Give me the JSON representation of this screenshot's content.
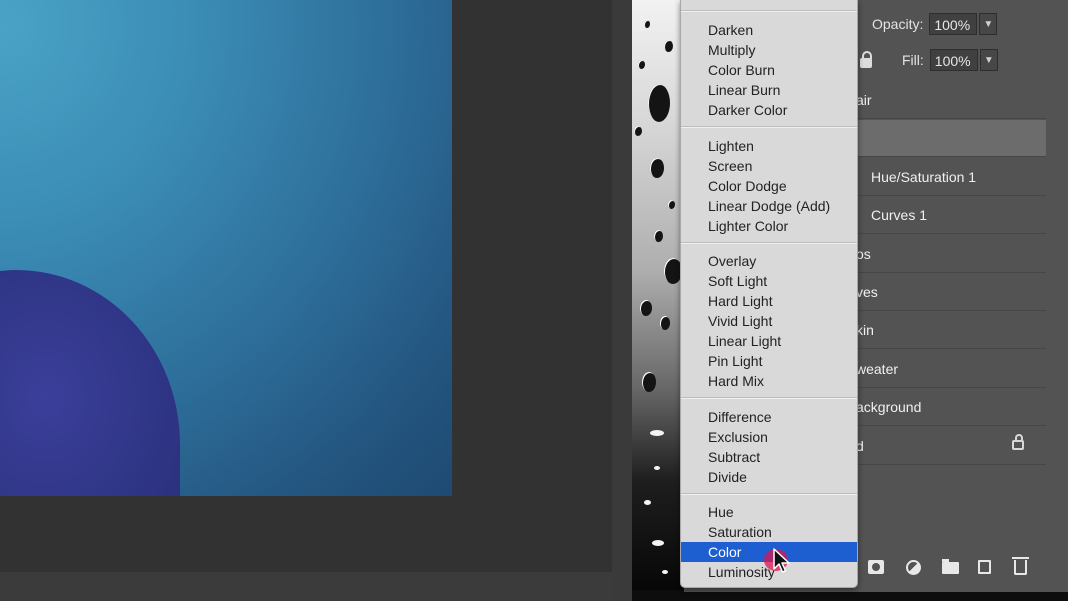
{
  "options": {
    "opacity_label": "Opacity:",
    "opacity_value": "100%",
    "fill_label": "Fill:",
    "fill_value": "100%"
  },
  "layers": [
    {
      "name": "air"
    },
    {
      "name": ""
    },
    {
      "name": "Hue/Saturation 1"
    },
    {
      "name": "Curves 1"
    },
    {
      "name": "os"
    },
    {
      "name": "ves"
    },
    {
      "name": "kin"
    },
    {
      "name": "weater"
    },
    {
      "name": "ackground"
    },
    {
      "name": "d"
    }
  ],
  "blend_menu": {
    "groups": [
      [
        "Darken",
        "Multiply",
        "Color Burn",
        "Linear Burn",
        "Darker Color"
      ],
      [
        "Lighten",
        "Screen",
        "Color Dodge",
        "Linear Dodge (Add)",
        "Lighter Color"
      ],
      [
        "Overlay",
        "Soft Light",
        "Hard Light",
        "Vivid Light",
        "Linear Light",
        "Pin Light",
        "Hard Mix"
      ],
      [
        "Difference",
        "Exclusion",
        "Subtract",
        "Divide"
      ],
      [
        "Hue",
        "Saturation",
        "Color",
        "Luminosity"
      ]
    ],
    "highlighted": "Color",
    "highlight_color": "#1d5fd1"
  },
  "footer_icons": [
    "mask-icon",
    "adjustment-icon",
    "folder-icon",
    "new-layer-icon",
    "trash-icon"
  ]
}
